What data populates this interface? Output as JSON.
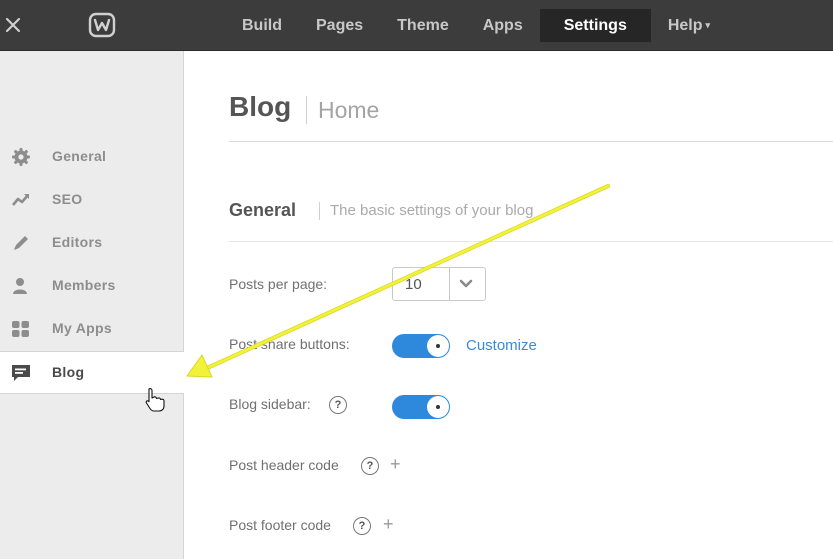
{
  "topbar": {
    "nav": [
      {
        "label": "Build"
      },
      {
        "label": "Pages"
      },
      {
        "label": "Theme"
      },
      {
        "label": "Apps"
      },
      {
        "label": "Settings",
        "active": true
      },
      {
        "label": "Help",
        "dropdown": true
      }
    ],
    "caret": "▾"
  },
  "sidebar": {
    "items": [
      {
        "label": "General",
        "icon": "gear-icon"
      },
      {
        "label": "SEO",
        "icon": "trend-icon"
      },
      {
        "label": "Editors",
        "icon": "pencil-icon"
      },
      {
        "label": "Members",
        "icon": "person-icon"
      },
      {
        "label": "My Apps",
        "icon": "grid-icon"
      },
      {
        "label": "Blog",
        "icon": "comment-icon",
        "active": true
      }
    ]
  },
  "main": {
    "title": "Blog",
    "subtitle": "Home",
    "section": {
      "title": "General",
      "subtitle": "The basic settings of your blog"
    },
    "rows": {
      "posts_per_page": {
        "label": "Posts per page:",
        "value": "10"
      },
      "share_buttons": {
        "label": "Post share buttons:",
        "on": true,
        "link": "Customize"
      },
      "blog_sidebar": {
        "label": "Blog sidebar:",
        "on": true,
        "help": "?"
      },
      "header_code": {
        "label": "Post header code",
        "help": "?",
        "add": "+"
      },
      "footer_code": {
        "label": "Post footer code",
        "help": "?",
        "add": "+"
      }
    }
  },
  "colors": {
    "topbar": "#3c3c3c",
    "accent": "#2e88dc",
    "arrow": "#f2f23a"
  }
}
